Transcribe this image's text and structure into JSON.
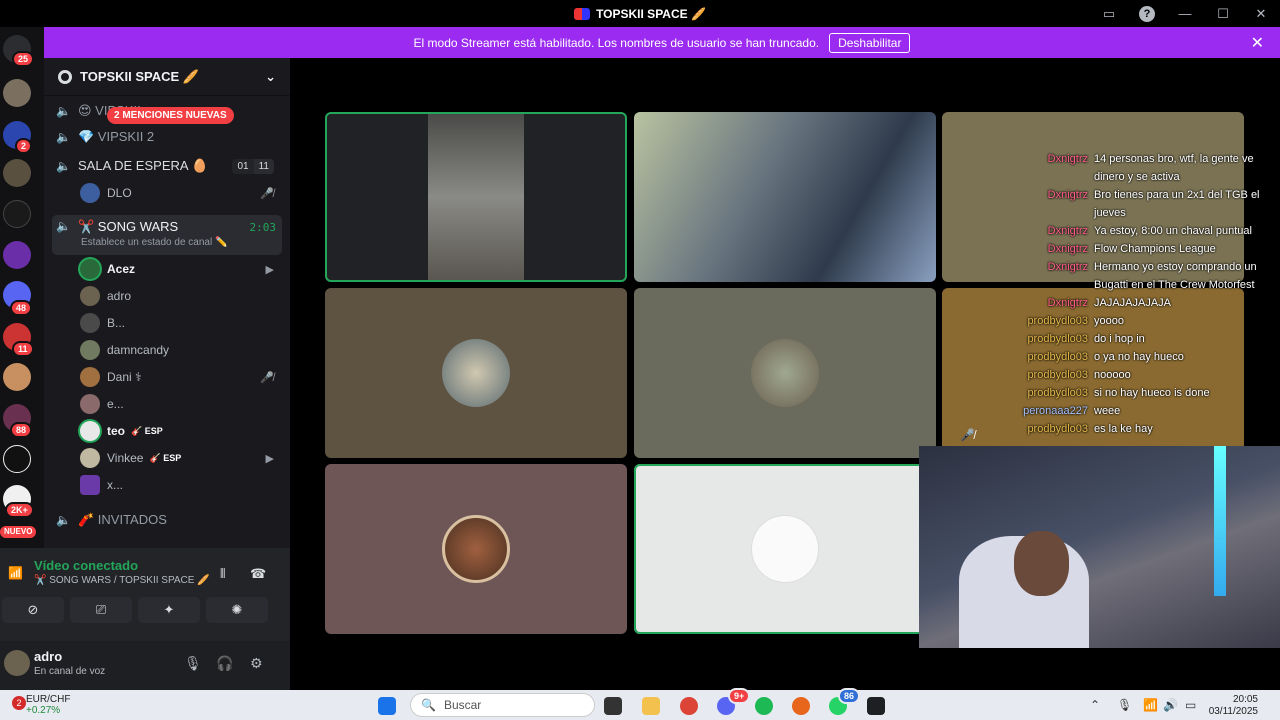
{
  "window": {
    "title": "TOPSKII SPACE 🥖"
  },
  "banner": {
    "text": "El modo Streamer está habilitado. Los nombres de usuario se han truncado.",
    "button": "Deshabilitar"
  },
  "rail": {
    "badges": [
      "25",
      "2",
      "48",
      "11",
      "88",
      "2K+",
      "NUEVO"
    ]
  },
  "server": {
    "name": "TOPSKII SPACE 🥖"
  },
  "channels": [
    {
      "name": "😍 VIPSKII",
      "muted": true
    },
    {
      "name": "💎 VIPSKII 2"
    },
    {
      "name": "SALA DE ESPERA 🥚",
      "count_a": "01",
      "count_b": "11"
    },
    {
      "name": "✂️ SONG WARS",
      "sub": "Establece un estado de canal ✏️",
      "timer": "2:03"
    },
    {
      "name": "🧨 INVITADOS"
    }
  ],
  "mentions_badge": "2 MENCIONES NUEVAS",
  "waiting_users": [
    {
      "name": "DLO"
    }
  ],
  "song_wars_users": [
    {
      "name": "Acez"
    },
    {
      "name": "adro"
    },
    {
      "name": "B..."
    },
    {
      "name": "damncandy"
    },
    {
      "name": "Dani ⚕"
    },
    {
      "name": "e..."
    },
    {
      "name": "teo",
      "tag": "🎸 ESP"
    },
    {
      "name": "Vinkee",
      "tag": "🎸 ESP"
    },
    {
      "name": "x..."
    }
  ],
  "voice": {
    "status": "Vídeo conectado",
    "channel": "✂️ SONG WARS / TOPSKII SPACE 🥖"
  },
  "me": {
    "name": "adro",
    "status": "En canal de voz"
  },
  "chat": [
    {
      "user": "Dxnigtrz",
      "color": "pink",
      "text": "14 personas bro, wtf, la gente ve"
    },
    {
      "user": "",
      "color": "pink",
      "text": "dinero y se activa"
    },
    {
      "user": "Dxnigtrz",
      "color": "pink",
      "text": "Bro tienes para un 2x1 del TGB el"
    },
    {
      "user": "",
      "color": "pink",
      "text": "jueves"
    },
    {
      "user": "Dxnigtrz",
      "color": "pink",
      "text": "Ya estoy, 8:00 un chaval puntual"
    },
    {
      "user": "Dxnigtrz",
      "color": "pink",
      "text": "Flow Champions League"
    },
    {
      "user": "Dxnigtrz",
      "color": "pink",
      "text": "Hermano yo estoy comprando un"
    },
    {
      "user": "",
      "color": "pink",
      "text": "Bugatti en el The Crew Motorfest"
    },
    {
      "user": "Dxnigtrz",
      "color": "pink",
      "text": "JAJAJAJAJAJA"
    },
    {
      "user": "prodbydlo03",
      "color": "gold",
      "text": "yoooo"
    },
    {
      "user": "prodbydlo03",
      "color": "gold",
      "text": "do i hop in"
    },
    {
      "user": "prodbydlo03",
      "color": "gold",
      "text": "o ya no hay hueco"
    },
    {
      "user": "prodbydlo03",
      "color": "gold",
      "text": "nooooo"
    },
    {
      "user": "prodbydlo03",
      "color": "gold",
      "text": "si no hay hueco is done"
    },
    {
      "user": "peronaaa227",
      "color": "blue",
      "text": "weee"
    },
    {
      "user": "prodbydlo03",
      "color": "gold",
      "text": "es la ke hay"
    }
  ],
  "taskbar": {
    "ticker": "EUR/CHF",
    "change": "+0.27%",
    "notif": "2",
    "search": "Buscar",
    "time": "20:05",
    "date": "03/11/2025",
    "badge_discord": "9+",
    "badge_whatsapp": "86"
  },
  "colors": {
    "accent": "#9b2bf0",
    "online": "#23a55a",
    "danger": "#f23f43"
  }
}
